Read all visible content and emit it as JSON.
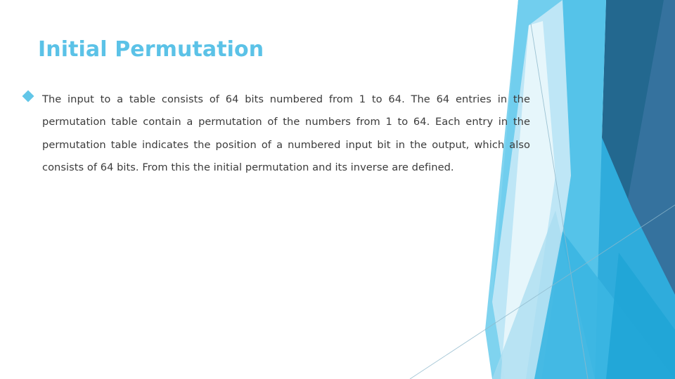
{
  "slide": {
    "title": "Initial Permutation",
    "bullets": [
      {
        "marker": "diamond-bullet-icon",
        "text": "The input to a table consists of 64 bits numbered from 1 to 64. The 64 entries in the permutation table contain a permutation of the numbers from 1 to 64. Each entry in the permutation table indicates the position of a numbered input bit in the output, which also consists of 64 bits. From this the initial permutation and its inverse are defined."
      }
    ]
  },
  "theme": {
    "background": "#ffffff",
    "title_color": "#5BC2E7",
    "body_color": "#3b3b3b",
    "bullet_color": "#62C6E8",
    "accent_pale": "#EAF7FC",
    "accent_lighter": "#CBEAF7",
    "accent_light": "#A8DCF0",
    "accent_sky": "#74CFEE",
    "accent_cyan": "#4EC0E6",
    "accent_medium": "#2FACDC",
    "accent_steel": "#4E8FBF",
    "accent_deep": "#2E7BAD",
    "accent_dark": "#23688F",
    "hairline": "#8FB9CC"
  }
}
